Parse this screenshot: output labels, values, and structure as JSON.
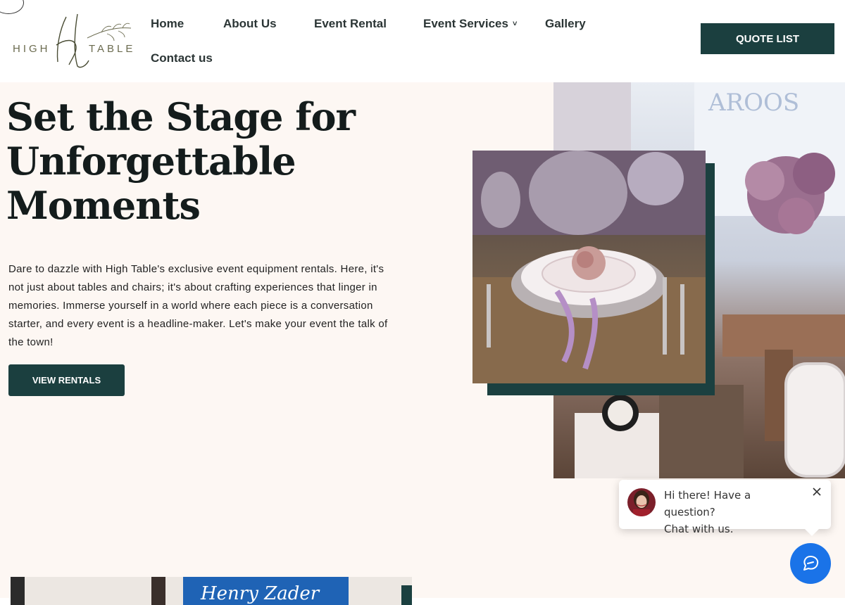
{
  "header": {
    "logo": {
      "text_left": "HIGH",
      "text_right": "TABLE"
    },
    "nav": [
      {
        "label": "Home"
      },
      {
        "label": "About Us"
      },
      {
        "label": "Event Rental"
      },
      {
        "label": "Event Services",
        "has_dropdown": true
      },
      {
        "label": "Gallery"
      },
      {
        "label": "Contact us"
      }
    ],
    "quote_button": "QUOTE LIST"
  },
  "hero": {
    "title_line1": "Set the Stage for",
    "title_line2": "Unforgettable",
    "title_line3": "Moments",
    "description": "Dare to dazzle with High Table's exclusive event equipment rentals. Here, it's not just about tables and chairs; it's about crafting experiences that linger in memories. Immerse yourself in a world where each piece is a conversation starter, and every event is a headline-maker. Let's make your event the talk of the town!",
    "button": "VIEW RENTALS"
  },
  "chat": {
    "line1": "Hi there! Have a question?",
    "line2": "Chat with us."
  },
  "colors": {
    "primary": "#1b3f3f",
    "hero_bg": "#fdf7f3",
    "chat_blue": "#1a73e8"
  },
  "icons": {
    "dropdown": "chevron-down-icon",
    "chat_close": "close-icon",
    "chat_launcher": "chat-icon"
  }
}
